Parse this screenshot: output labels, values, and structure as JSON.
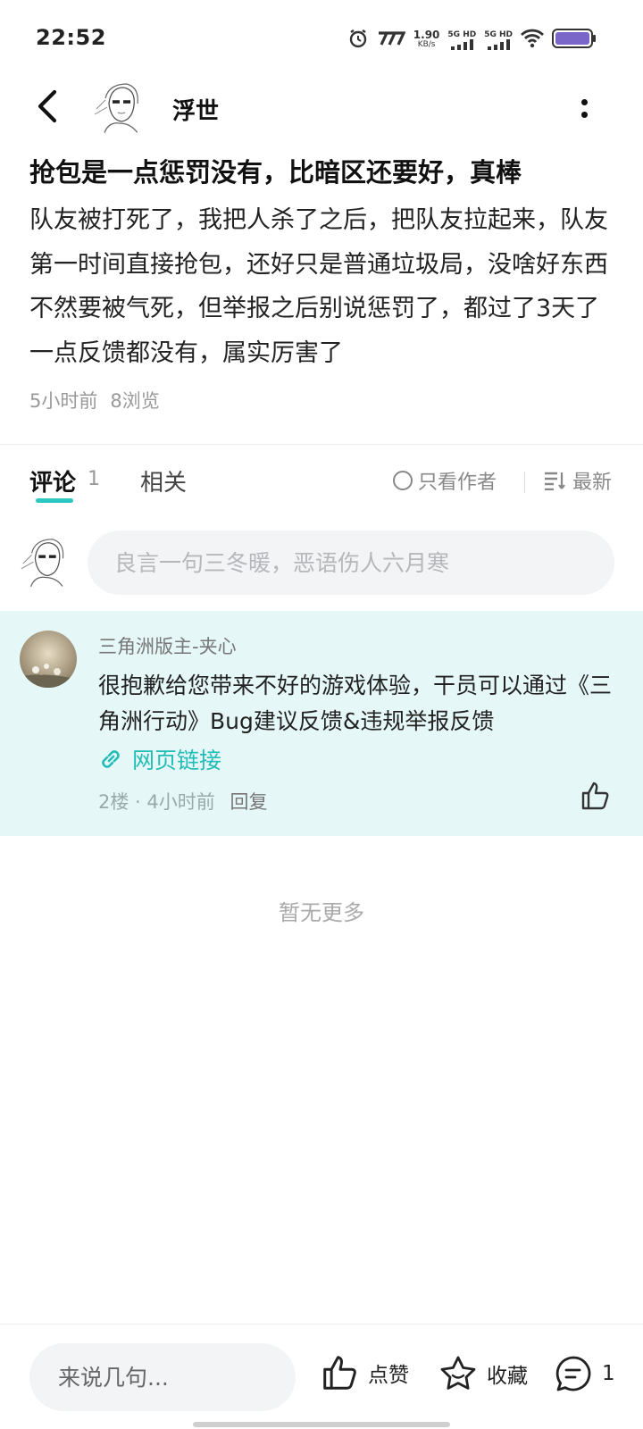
{
  "status_bar": {
    "time": "22:52",
    "net_speed_value": "1.90",
    "net_speed_unit": "KB/s",
    "sim1_label": "5G HD",
    "sim2_label": "5G HD",
    "icons": [
      "alarm-icon",
      "signal-app-icon",
      "signal-icon",
      "signal-icon",
      "wifi-icon",
      "battery-icon"
    ]
  },
  "header": {
    "author_name": "浮世",
    "icons": [
      "back-arrow-icon",
      "more-vertical-icon"
    ]
  },
  "post": {
    "title": "抢包是一点惩罚没有，比暗区还要好，真棒",
    "body": "队友被打死了，我把人杀了之后，把队友拉起来，队友第一时间直接抢包，还好只是普通垃圾局，没啥好东西不然要被气死，但举报之后别说惩罚了，都过了3天了一点反馈都没有，属实厉害了",
    "time_ago": "5小时前",
    "views": "8浏览"
  },
  "tabs": {
    "comments_label": "评论",
    "comments_count": "1",
    "related_label": "相关",
    "author_only_label": "只看作者",
    "sort_label": "最新"
  },
  "comment_input": {
    "placeholder": "良言一句三冬暖，恶语伤人六月寒"
  },
  "comment": {
    "author": "三角洲版主-夹心",
    "text": "很抱歉给您带来不好的游戏体验，干员可以通过《三角洲行动》Bug建议反馈&违规举报反馈",
    "link_label": "网页链接",
    "floor": "2楼",
    "time_ago": "4小时前",
    "reply_label": "回复"
  },
  "no_more_label": "暂无更多",
  "bottom_bar": {
    "input_placeholder": "来说几句...",
    "like_label": "点赞",
    "favorite_label": "收藏",
    "comment_count": "1"
  },
  "colors": {
    "accent": "#2bc7c0",
    "link": "#22bdb6",
    "highlight_bg": "#e6f7f7",
    "battery": "#7a66c9"
  }
}
